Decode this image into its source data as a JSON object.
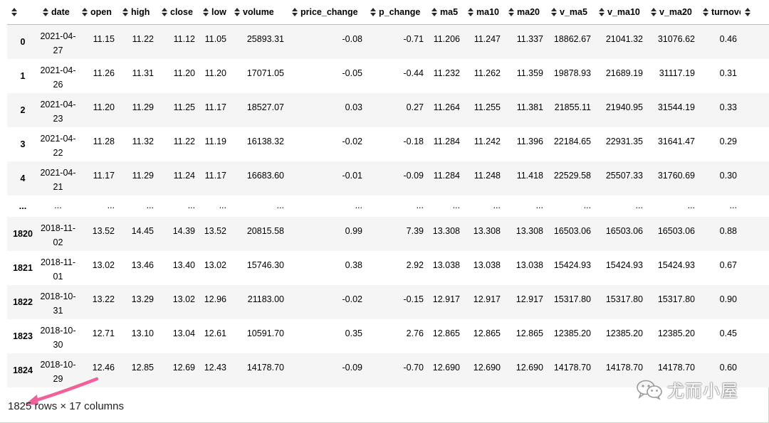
{
  "table": {
    "columns": [
      "date",
      "open",
      "high",
      "close",
      "low",
      "volume",
      "price_change",
      "p_change",
      "ma5",
      "ma10",
      "ma20",
      "v_ma5",
      "v_ma10",
      "v_ma20",
      "turnover"
    ],
    "rows": [
      {
        "index": "0",
        "date": "2021-04-27",
        "cells": [
          "11.15",
          "11.22",
          "11.12",
          "11.05",
          "25893.31",
          "-0.08",
          "-0.71",
          "11.206",
          "11.247",
          "11.337",
          "18862.67",
          "21041.32",
          "31076.62",
          "0.46"
        ]
      },
      {
        "index": "1",
        "date": "2021-04-26",
        "cells": [
          "11.26",
          "11.31",
          "11.20",
          "11.20",
          "17071.05",
          "-0.05",
          "-0.44",
          "11.232",
          "11.262",
          "11.359",
          "19878.93",
          "21689.19",
          "31117.19",
          "0.31"
        ]
      },
      {
        "index": "2",
        "date": "2021-04-23",
        "cells": [
          "11.20",
          "11.29",
          "11.25",
          "11.17",
          "18527.07",
          "0.03",
          "0.27",
          "11.264",
          "11.255",
          "11.381",
          "21855.11",
          "21940.95",
          "31544.19",
          "0.33"
        ]
      },
      {
        "index": "3",
        "date": "2021-04-22",
        "cells": [
          "11.28",
          "11.32",
          "11.22",
          "11.19",
          "16138.32",
          "-0.02",
          "-0.18",
          "11.284",
          "11.242",
          "11.396",
          "22184.65",
          "22931.35",
          "31641.47",
          "0.29"
        ]
      },
      {
        "index": "4",
        "date": "2021-04-21",
        "cells": [
          "11.17",
          "11.29",
          "11.24",
          "11.17",
          "16683.60",
          "-0.01",
          "-0.09",
          "11.284",
          "11.248",
          "11.418",
          "22529.58",
          "25507.33",
          "31760.69",
          "0.30"
        ]
      },
      {
        "index": "...",
        "date": "...",
        "ellipsis": true,
        "cells": [
          "...",
          "...",
          "...",
          "...",
          "...",
          "...",
          "...",
          "...",
          "...",
          "...",
          "...",
          "...",
          "...",
          "..."
        ]
      },
      {
        "index": "1820",
        "date": "2018-11-02",
        "cells": [
          "13.52",
          "14.45",
          "14.39",
          "13.52",
          "20815.58",
          "0.99",
          "7.39",
          "13.308",
          "13.308",
          "13.308",
          "16503.06",
          "16503.06",
          "16503.06",
          "0.88"
        ]
      },
      {
        "index": "1821",
        "date": "2018-11-01",
        "cells": [
          "13.02",
          "13.46",
          "13.40",
          "13.02",
          "15746.30",
          "0.38",
          "2.92",
          "13.038",
          "13.038",
          "13.038",
          "15424.93",
          "15424.93",
          "15424.93",
          "0.67"
        ]
      },
      {
        "index": "1822",
        "date": "2018-10-31",
        "cells": [
          "13.22",
          "13.29",
          "13.02",
          "12.96",
          "21183.00",
          "-0.02",
          "-0.15",
          "12.917",
          "12.917",
          "12.917",
          "15317.80",
          "15317.80",
          "15317.80",
          "0.90"
        ]
      },
      {
        "index": "1823",
        "date": "2018-10-30",
        "cells": [
          "12.71",
          "13.10",
          "13.04",
          "12.61",
          "10591.70",
          "0.35",
          "2.76",
          "12.865",
          "12.865",
          "12.865",
          "12385.20",
          "12385.20",
          "12385.20",
          "0.45"
        ]
      },
      {
        "index": "1824",
        "date": "2018-10-29",
        "cells": [
          "12.46",
          "12.85",
          "12.69",
          "12.43",
          "14178.70",
          "-0.09",
          "-0.70",
          "12.690",
          "12.690",
          "12.690",
          "14178.70",
          "14178.70",
          "14178.70",
          "0.60"
        ]
      }
    ]
  },
  "footer": {
    "shape_text": "1825 rows × 17 columns"
  },
  "watermark": {
    "text": "尤而小屋",
    "icon": "wechat-icon"
  },
  "colors": {
    "arrow": "#f0609a",
    "row_stripe": "#f5f5f5"
  }
}
